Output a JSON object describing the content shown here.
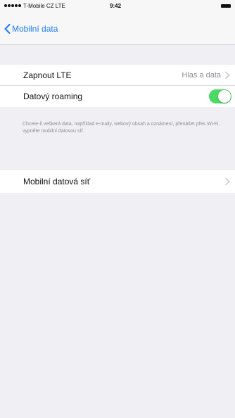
{
  "status_bar": {
    "carrier": "T-Mobile CZ  LTE",
    "time": "9:42"
  },
  "nav": {
    "back_label": "Mobilní data"
  },
  "settings": {
    "lte_label": "Zapnout LTE",
    "lte_value": "Hlas a data",
    "roaming_label": "Datový roaming",
    "roaming_enabled": true,
    "roaming_footer": "Chcete-li veškerá data, například e-maily, webový obsah a oznámení, přenášet přes Wi-Fi, vypněte mobilní datovou síť.",
    "network_label": "Mobilní datová síť"
  },
  "colors": {
    "accent": "#1a7cf5",
    "toggle_on": "#4cd964",
    "brand_marker": "#e5097f"
  }
}
